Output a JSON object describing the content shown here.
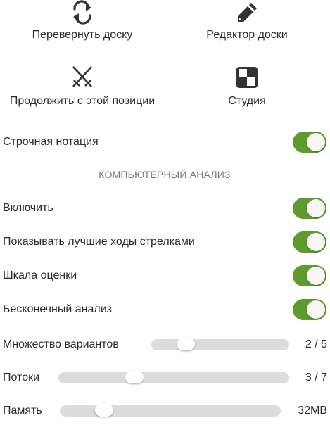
{
  "actions": {
    "flip": {
      "label": "Перевернуть доску",
      "icon": "flip-board-icon"
    },
    "editor": {
      "label": "Редактор доски",
      "icon": "pencil-icon"
    },
    "continue": {
      "label": "Продолжить с этой позиции",
      "icon": "crossed-swords-icon"
    },
    "study": {
      "label": "Студия",
      "icon": "study-board-icon"
    }
  },
  "settings": {
    "inline_notation": {
      "label": "Строчная нотация",
      "on": true
    }
  },
  "analysis": {
    "section_title": "КОМПЬЮТЕРНЫЙ АНАЛИЗ",
    "enable": {
      "label": "Включить",
      "on": true
    },
    "arrows": {
      "label": "Показывать лучшие ходы стрелками",
      "on": true
    },
    "gauge": {
      "label": "Шкала оценки",
      "on": true
    },
    "infinite": {
      "label": "Бесконечный анализ",
      "on": true
    },
    "multipv": {
      "label": "Множество вариантов",
      "value": "2 / 5",
      "fraction": 0.25
    },
    "threads": {
      "label": "Потоки",
      "value": "3 / 7",
      "fraction": 0.33
    },
    "memory": {
      "label": "Память",
      "value": "32MB",
      "fraction": 0.2
    }
  },
  "colors": {
    "toggle_on": "#5f9b2c",
    "track": "#dcdcdc",
    "text": "#2b2b2b",
    "section": "#777777"
  }
}
